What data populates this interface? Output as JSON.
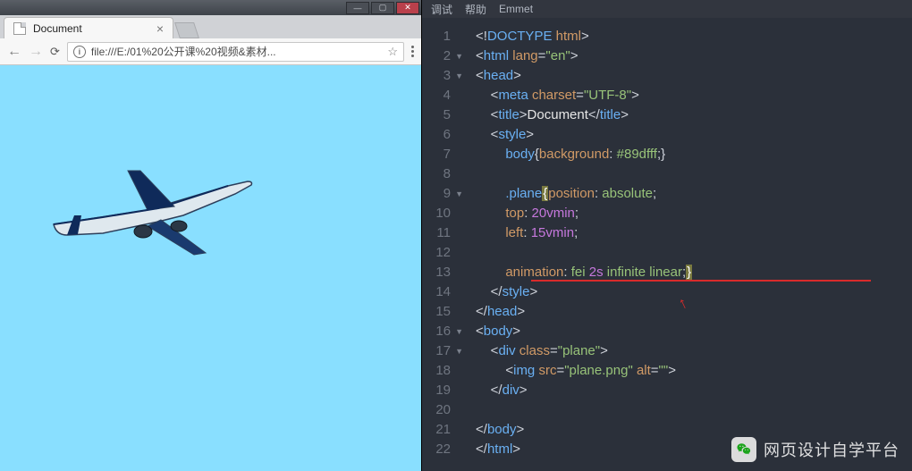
{
  "os_buttons": {
    "min": "—",
    "max": "▢",
    "close": "✕"
  },
  "tab": {
    "title": "Document"
  },
  "addrbar": {
    "url": "file:///E:/01%20公开课%20视频&素材..."
  },
  "menu": {
    "debug": "调试",
    "help": "帮助",
    "emmet": "Emmet"
  },
  "code": {
    "lines": [
      {
        "n": "1",
        "fold": "",
        "html": "<span class='t-punc'>&lt;!</span><span class='t-tag'>DOCTYPE</span> <span class='t-attr'>html</span><span class='t-punc'>&gt;</span>"
      },
      {
        "n": "2",
        "fold": "▼",
        "html": "<span class='t-punc'>&lt;</span><span class='t-tag'>html</span> <span class='t-attr'>lang</span><span class='t-punc'>=</span><span class='t-str'>\"en\"</span><span class='t-punc'>&gt;</span>"
      },
      {
        "n": "3",
        "fold": "▼",
        "html": "<span class='t-punc'>&lt;</span><span class='t-tag'>head</span><span class='t-punc'>&gt;</span>"
      },
      {
        "n": "4",
        "fold": "",
        "html": "    <span class='t-punc'>&lt;</span><span class='t-tag'>meta</span> <span class='t-attr'>charset</span><span class='t-punc'>=</span><span class='t-str'>\"UTF-8\"</span><span class='t-punc'>&gt;</span>"
      },
      {
        "n": "5",
        "fold": "",
        "html": "    <span class='t-punc'>&lt;</span><span class='t-tag'>title</span><span class='t-punc'>&gt;</span><span class='t-txt'>Document</span><span class='t-punc'>&lt;/</span><span class='t-tag'>title</span><span class='t-punc'>&gt;</span>"
      },
      {
        "n": "6",
        "fold": "",
        "html": "    <span class='t-punc'>&lt;</span><span class='t-tag'>style</span><span class='t-punc'>&gt;</span>"
      },
      {
        "n": "7",
        "fold": "",
        "html": "        <span class='t-tag'>body</span><span class='t-punc'>{</span><span class='t-prop'>background</span><span class='t-punc'>:</span> <span class='t-val'>#89dfff</span><span class='t-punc'>;}</span>"
      },
      {
        "n": "8",
        "fold": "",
        "html": ""
      },
      {
        "n": "9",
        "fold": "▼",
        "html": "        <span class='t-tag'>.plane</span><span class='hl-brace'>{</span><span class='t-prop'>position</span><span class='t-punc'>:</span> <span class='t-val'>absolute</span><span class='t-punc'>;</span>"
      },
      {
        "n": "10",
        "fold": "",
        "html": "        <span class='t-prop'>top</span><span class='t-punc'>:</span> <span class='t-num'>20vmin</span><span class='t-punc'>;</span>"
      },
      {
        "n": "11",
        "fold": "",
        "html": "        <span class='t-prop'>left</span><span class='t-punc'>:</span> <span class='t-num'>15vmin</span><span class='t-punc'>;</span>"
      },
      {
        "n": "12",
        "fold": "",
        "html": ""
      },
      {
        "n": "13",
        "fold": "",
        "html": "        <span class='t-prop'>animation</span><span class='t-punc'>:</span> <span class='t-val'>fei</span> <span class='t-num'>2s</span> <span class='t-val'>infinite</span> <span class='t-val'>linear</span><span class='t-punc'>;</span><span class='hl-brace'>}</span>"
      },
      {
        "n": "14",
        "fold": "",
        "html": "    <span class='t-punc'>&lt;/</span><span class='t-tag'>style</span><span class='t-punc'>&gt;</span>"
      },
      {
        "n": "15",
        "fold": "",
        "html": "<span class='t-punc'>&lt;/</span><span class='t-tag'>head</span><span class='t-punc'>&gt;</span>"
      },
      {
        "n": "16",
        "fold": "▼",
        "html": "<span class='t-punc'>&lt;</span><span class='t-tag'>body</span><span class='t-punc'>&gt;</span>"
      },
      {
        "n": "17",
        "fold": "▼",
        "html": "    <span class='t-punc'>&lt;</span><span class='t-tag'>div</span> <span class='t-attr'>class</span><span class='t-punc'>=</span><span class='t-str'>\"plane\"</span><span class='t-punc'>&gt;</span>"
      },
      {
        "n": "18",
        "fold": "",
        "html": "        <span class='t-punc'>&lt;</span><span class='t-tag'>img</span> <span class='t-attr'>src</span><span class='t-punc'>=</span><span class='t-str'>\"plane.png\"</span> <span class='t-attr'>alt</span><span class='t-punc'>=</span><span class='t-str'>\"\"</span><span class='t-punc'>&gt;</span>"
      },
      {
        "n": "19",
        "fold": "",
        "html": "    <span class='t-punc'>&lt;/</span><span class='t-tag'>div</span><span class='t-punc'>&gt;</span>"
      },
      {
        "n": "20",
        "fold": "",
        "html": ""
      },
      {
        "n": "21",
        "fold": "",
        "html": "<span class='t-punc'>&lt;/</span><span class='t-tag'>body</span><span class='t-punc'>&gt;</span>"
      },
      {
        "n": "22",
        "fold": "",
        "html": "<span class='t-punc'>&lt;/</span><span class='t-tag'>html</span><span class='t-punc'>&gt;</span>"
      }
    ]
  },
  "watermark": {
    "text": "网页设计自学平台"
  }
}
